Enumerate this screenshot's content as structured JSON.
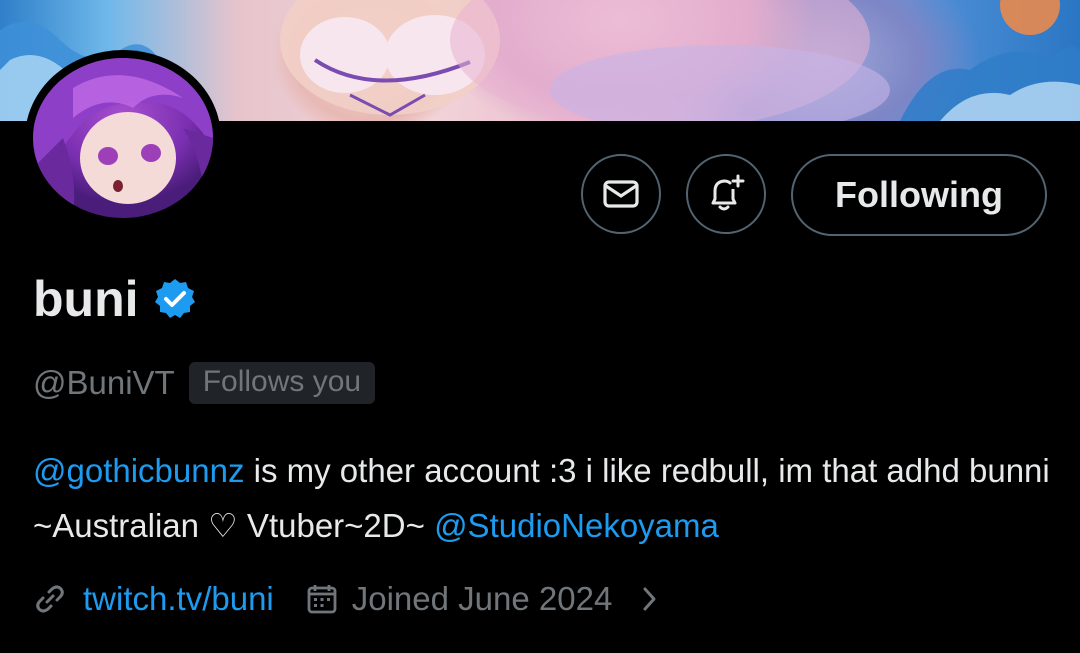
{
  "profile": {
    "display_name": "buni",
    "handle": "@BuniVT",
    "follows_you_badge": "Follows you",
    "verified": true
  },
  "actions": {
    "message_icon": "envelope-icon",
    "notify_icon": "bell-plus-icon",
    "follow_label": "Following"
  },
  "bio": {
    "mention_1": "@gothicbunnz",
    "text_1": " is my other account :3 i like redbull, im that adhd bunni ~Australian ♡ Vtuber~2D~ ",
    "mention_2": "@StudioNekoyama"
  },
  "meta": {
    "link_icon": "link-icon",
    "link": "twitch.tv/buni",
    "calendar_icon": "calendar-icon",
    "joined": "Joined June 2024",
    "chevron_icon": "chevron-right-icon"
  },
  "colors": {
    "background": "#000000",
    "text_primary": "#e7e9ea",
    "text_secondary": "#71767b",
    "accent": "#1d9bf0",
    "border": "#536471"
  }
}
